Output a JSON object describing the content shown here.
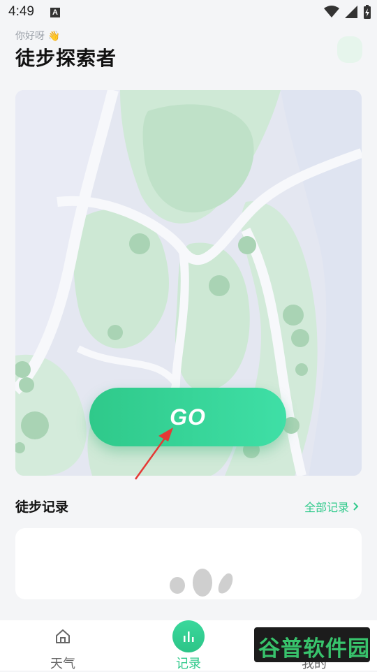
{
  "status_bar": {
    "time": "4:49",
    "notif_letter": "A"
  },
  "header": {
    "greeting": "你好呀 👋",
    "title": "徒步探索者"
  },
  "map": {
    "go_label": "GO"
  },
  "records": {
    "section_title": "徒步记录",
    "all_link": "全部记录"
  },
  "bottom_nav": {
    "items": [
      {
        "label": "天气",
        "icon": "home-icon"
      },
      {
        "label": "记录",
        "icon": "bar-chart-icon",
        "active": true
      },
      {
        "label": "我的",
        "icon": "person-icon"
      }
    ]
  },
  "watermark": {
    "text": "谷普软件园"
  },
  "colors": {
    "accent": "#2ec98a",
    "accent_light": "#3fdfa6",
    "background": "#f4f5f7"
  }
}
